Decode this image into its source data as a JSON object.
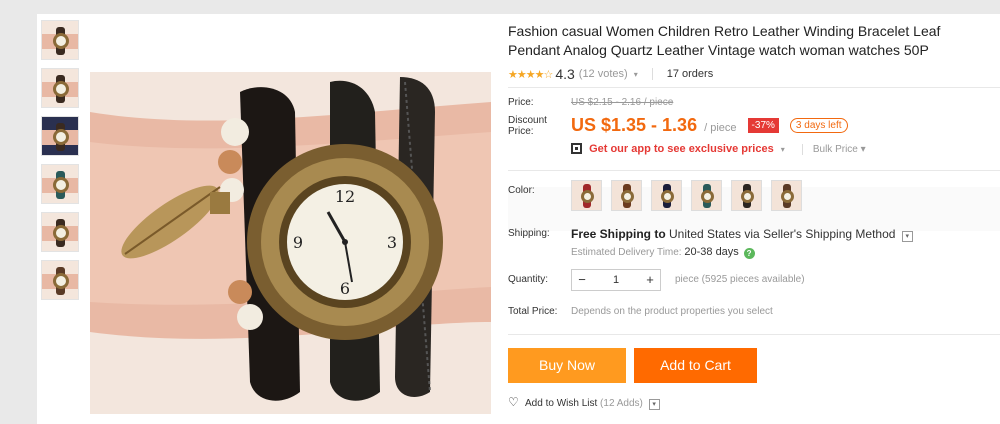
{
  "product": {
    "title": "Fashion casual Women Children Retro Leather Winding Bracelet Leaf Pendant Analog Quartz Leather Vintage watch woman watches 50P"
  },
  "rating": {
    "stars_icon": "★★★★☆",
    "value": "4.3",
    "votes": "(12 votes)",
    "orders": "17 orders"
  },
  "price": {
    "label": "Price:",
    "original": "US $2.15 - 2.16 / piece",
    "discount_label": "Discount Price:",
    "current": "US $1.35 - 1.36",
    "unit": "/ piece",
    "discount_badge": "-37%",
    "time_left": "3 days left",
    "app_promo": "Get our app to see exclusive prices",
    "bulk_price": "Bulk Price"
  },
  "color": {
    "label": "Color:",
    "swatch_colors": [
      "#a0282a",
      "#6b3a1e",
      "#1a1d3a",
      "#2a5a5a",
      "#2b2520",
      "#5a3a26"
    ]
  },
  "shipping": {
    "label": "Shipping:",
    "free": "Free Shipping to",
    "destination": "United States via Seller's Shipping Method",
    "estimated_label": "Estimated Delivery Time:",
    "estimated_days": "20-38 days"
  },
  "quantity": {
    "label": "Quantity:",
    "value": "1",
    "minus": "−",
    "plus": "+",
    "available": "piece (5925 pieces available)"
  },
  "total": {
    "label": "Total Price:",
    "note": "Depends on the product properties you select"
  },
  "actions": {
    "buy_now": "Buy Now",
    "add_to_cart": "Add to Cart",
    "wishlist": "Add to Wish List",
    "wishlist_count": "(12 Adds)"
  },
  "colors": {
    "price_orange": "#f2690f",
    "buy_now_bg": "#ff9a1f",
    "add_cart_bg": "#ff6a00",
    "discount_red": "#e53935"
  }
}
